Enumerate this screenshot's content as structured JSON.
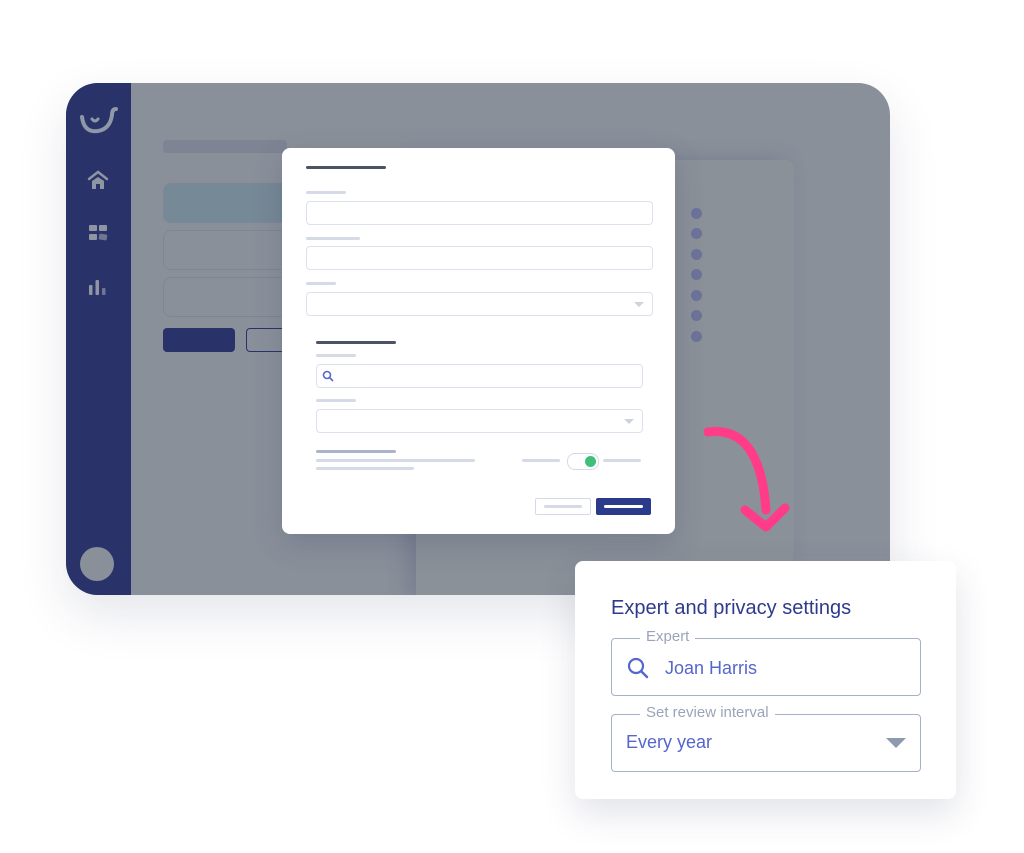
{
  "app": {
    "sidebar": {
      "items": [
        {
          "icon": "logo-smile-icon"
        },
        {
          "icon": "home-icon"
        },
        {
          "icon": "dashboard-icon"
        },
        {
          "icon": "bar-chart-icon"
        }
      ],
      "avatar": "user-avatar"
    },
    "modal": {
      "toggle_on": true,
      "accent_color": "#2c3a8c",
      "toggle_color": "#3fc07a"
    }
  },
  "settings_card": {
    "title": "Expert and privacy settings",
    "expert": {
      "label": "Expert",
      "value": "Joan Harris",
      "icon": "search-icon"
    },
    "review_interval": {
      "label": "Set review interval",
      "value": "Every year",
      "icon": "caret-down-icon"
    }
  },
  "colors": {
    "sidebar": "#29336a",
    "arrow": "#ff3b8a",
    "title": "#2e3b8c",
    "value": "#5566cc"
  }
}
